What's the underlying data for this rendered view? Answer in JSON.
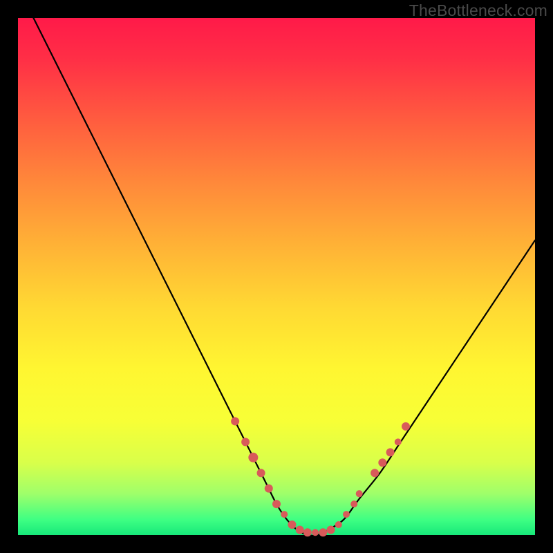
{
  "watermark": "TheBottleneck.com",
  "chart_data": {
    "type": "line",
    "title": "",
    "xlabel": "",
    "ylabel": "",
    "xlim": [
      0,
      100
    ],
    "ylim": [
      0,
      100
    ],
    "grid": false,
    "legend": false,
    "series": [
      {
        "name": "bottleneck-curve",
        "x": [
          3,
          6,
          10,
          14,
          18,
          22,
          26,
          30,
          34,
          38,
          42,
          45,
          48,
          50,
          52,
          54,
          56,
          58,
          60,
          63,
          66,
          70,
          74,
          78,
          82,
          86,
          90,
          94,
          98,
          100
        ],
        "y": [
          100,
          94,
          86,
          78,
          70,
          62,
          54,
          46,
          38,
          30,
          22,
          16,
          10,
          6,
          3,
          1,
          0,
          0,
          1,
          3,
          7,
          12,
          18,
          24,
          30,
          36,
          42,
          48,
          54,
          57
        ]
      }
    ],
    "markers": {
      "name": "highlight-dots",
      "color": "#d85a5a",
      "points": [
        {
          "x": 42,
          "y": 22,
          "r": 6
        },
        {
          "x": 44,
          "y": 18,
          "r": 6
        },
        {
          "x": 45.5,
          "y": 15,
          "r": 7
        },
        {
          "x": 47,
          "y": 12,
          "r": 6
        },
        {
          "x": 48.5,
          "y": 9,
          "r": 6
        },
        {
          "x": 50,
          "y": 6,
          "r": 6
        },
        {
          "x": 51.5,
          "y": 4,
          "r": 5
        },
        {
          "x": 53,
          "y": 2,
          "r": 6
        },
        {
          "x": 54.5,
          "y": 1,
          "r": 6
        },
        {
          "x": 56,
          "y": 0.5,
          "r": 6
        },
        {
          "x": 57.5,
          "y": 0.5,
          "r": 5
        },
        {
          "x": 59,
          "y": 0.5,
          "r": 6
        },
        {
          "x": 60.5,
          "y": 1,
          "r": 6
        },
        {
          "x": 62,
          "y": 2,
          "r": 5
        },
        {
          "x": 63.5,
          "y": 4,
          "r": 5
        },
        {
          "x": 65,
          "y": 6,
          "r": 5
        },
        {
          "x": 66,
          "y": 8,
          "r": 5
        },
        {
          "x": 69,
          "y": 12,
          "r": 6
        },
        {
          "x": 70.5,
          "y": 14,
          "r": 6
        },
        {
          "x": 72,
          "y": 16,
          "r": 6
        },
        {
          "x": 73.5,
          "y": 18,
          "r": 5
        },
        {
          "x": 75,
          "y": 21,
          "r": 6
        }
      ]
    }
  }
}
